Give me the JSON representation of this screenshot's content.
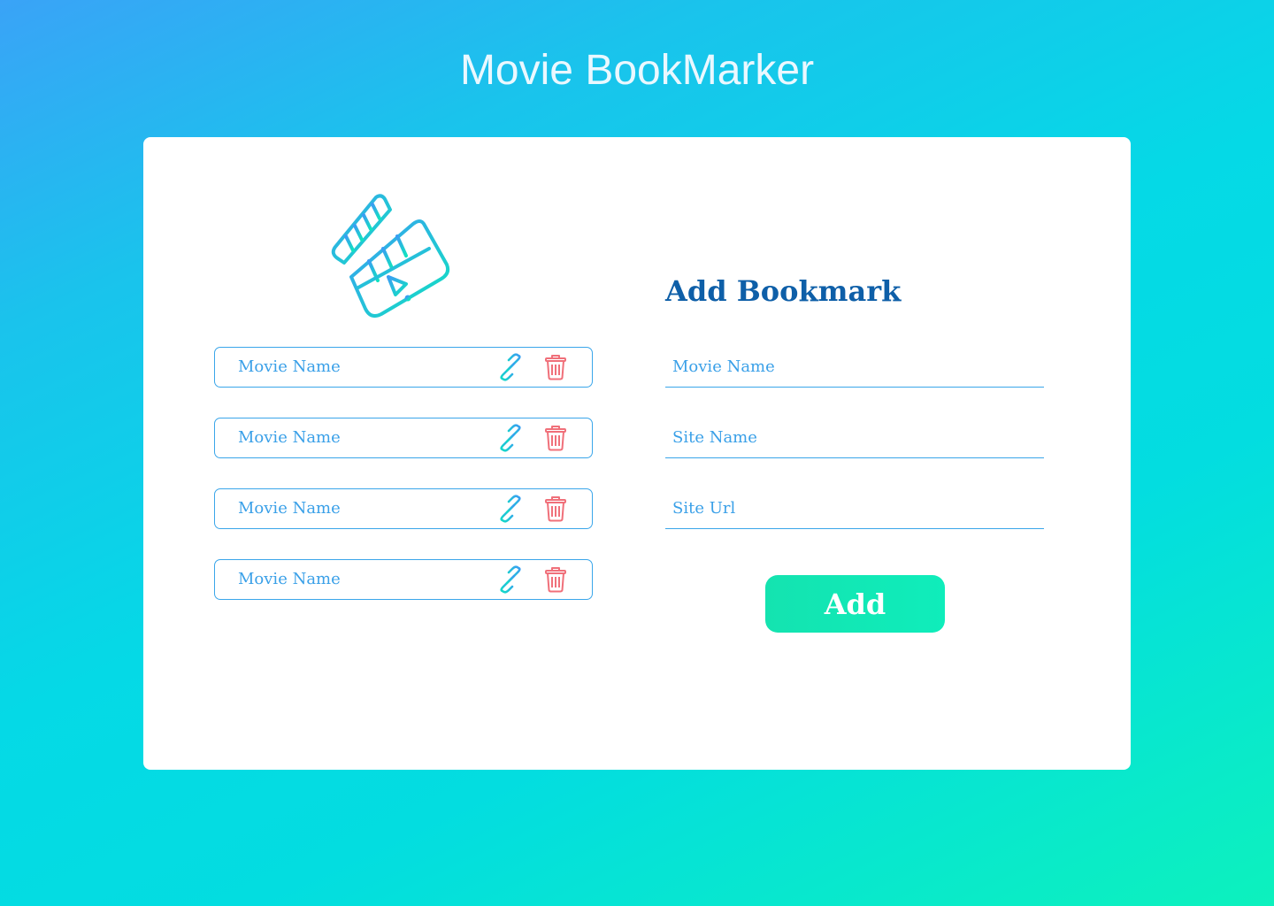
{
  "app": {
    "title": "Movie BookMarker"
  },
  "bookmarks": [
    {
      "name": "Movie Name",
      "link_icon": "link-icon",
      "delete_icon": "trash-icon"
    },
    {
      "name": "Movie Name",
      "link_icon": "link-icon",
      "delete_icon": "trash-icon"
    },
    {
      "name": "Movie Name",
      "link_icon": "link-icon",
      "delete_icon": "trash-icon"
    },
    {
      "name": "Movie Name",
      "link_icon": "link-icon",
      "delete_icon": "trash-icon"
    }
  ],
  "form": {
    "title": "Add Bookmark",
    "movie_name": {
      "value": "",
      "placeholder": "Movie Name"
    },
    "site_name": {
      "value": "",
      "placeholder": "Site Name"
    },
    "site_url": {
      "value": "",
      "placeholder": "Site Url"
    },
    "add_label": "Add"
  },
  "icons": {
    "logo": "clapperboard-icon",
    "link": "link-icon",
    "delete": "trash-icon"
  },
  "colors": {
    "accent_blue": "#3aa6ea",
    "title_blue": "#0e5fa8",
    "delete_red": "#f0707a",
    "add_green": "#10e8b6",
    "background_start": "#3aa3f7",
    "background_end": "#0df1bd"
  }
}
